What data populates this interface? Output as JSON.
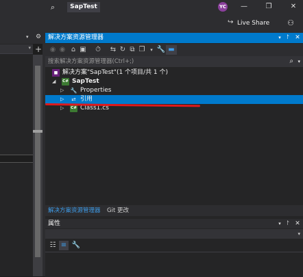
{
  "title_bar": {
    "solution_name": "SapTest",
    "avatar_initials": "YC",
    "minimize": "—",
    "restore": "❐",
    "close": "✕"
  },
  "toolbar": {
    "live_share_label": "Live Share"
  },
  "solution_explorer": {
    "title": "解决方案资源管理器",
    "search_placeholder": "搜索解决方案资源管理器(Ctrl+;)",
    "tree": [
      {
        "label": "解决方案\"SapTest\"(1 个项目/共 1 个)",
        "icon": "solution-icon",
        "selected": false
      },
      {
        "label": "SapTest",
        "icon": "csharp-project-icon",
        "selected": false,
        "expanded": true
      },
      {
        "label": "Properties",
        "icon": "wrench-icon",
        "selected": false
      },
      {
        "label": "引用",
        "icon": "references-icon",
        "selected": true
      },
      {
        "label": "Class1.cs",
        "icon": "csharp-file-icon",
        "selected": false
      }
    ],
    "tabs": [
      "解决方案资源管理器",
      "Git 更改"
    ],
    "accent_color": "#007acc",
    "annotation_color": "#e0191b"
  },
  "properties": {
    "title": "属性"
  }
}
